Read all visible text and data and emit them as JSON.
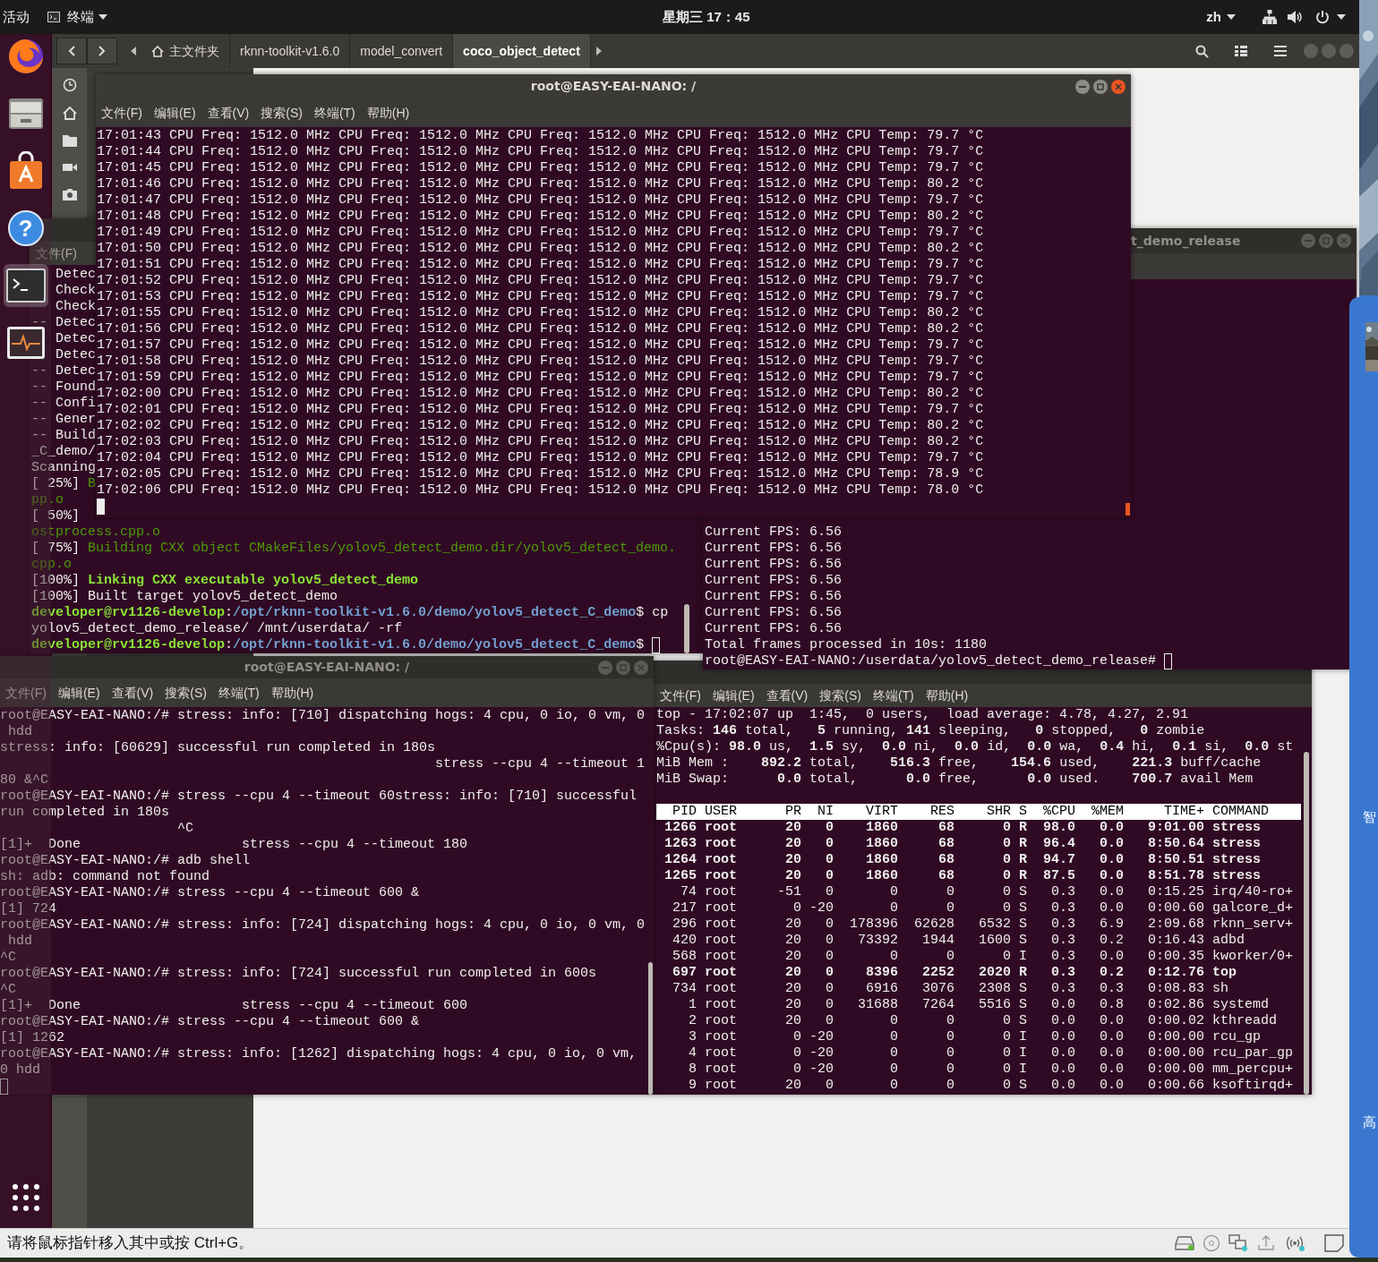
{
  "top_bar": {
    "activities": "活动",
    "app_menu": "终端",
    "clock": "星期三 17：45",
    "language": "zh"
  },
  "dock": {
    "items": [
      {
        "kind": "browser",
        "selected": false
      },
      {
        "kind": "files",
        "selected": false
      },
      {
        "kind": "store",
        "selected": false
      },
      {
        "kind": "help",
        "glyph": "?",
        "selected": false
      },
      {
        "kind": "terminal",
        "selected": true
      },
      {
        "kind": "monitor",
        "selected": false
      },
      {
        "kind": "apps",
        "selected": false
      }
    ]
  },
  "files_window": {
    "path": [
      {
        "kind": "home",
        "label": "主文件夹",
        "selected": false
      },
      {
        "kind": "folder",
        "label": "rknn-toolkit-v1.6.0",
        "selected": false
      },
      {
        "kind": "folder",
        "label": "model_convert",
        "selected": false
      },
      {
        "kind": "folder",
        "label": "coco_object_detect",
        "selected": true
      }
    ]
  },
  "build_terminal": {
    "menu": [
      "文件(F)"
    ],
    "lines": [
      "   Detec",
      "   Check",
      "   Check",
      "-- Detec",
      "   Detec",
      "   Detec",
      "-- Detec",
      "-- Found",
      "-- Confi",
      "-- Gener",
      "-- Build",
      "_C_demo/",
      "Scanning",
      {
        "spans": [
          {
            "kind": "plain",
            "text": "[ 25%] "
          },
          {
            "kind": "green",
            "text": "B"
          }
        ]
      },
      {
        "spans": [
          {
            "kind": "green",
            "text": "pp.o"
          }
        ]
      },
      "[ 50%]",
      {
        "spans": [
          {
            "kind": "green",
            "text": "ostprocess.cpp.o"
          }
        ]
      },
      {
        "spans": [
          {
            "kind": "plain",
            "text": "[ 75%] "
          },
          {
            "kind": "green",
            "text": "Building CXX object CMakeFiles/yolov5_detect_demo.dir/yolov5_detect_demo."
          }
        ]
      },
      {
        "spans": [
          {
            "kind": "green",
            "text": "cpp.o"
          }
        ]
      },
      {
        "spans": [
          {
            "kind": "plain",
            "text": "[100%] "
          },
          {
            "kind": "green-bold",
            "text": "Linking CXX executable yolov5_detect_demo"
          }
        ]
      },
      "[100%] Built target yolov5_detect_demo",
      {
        "spans": [
          {
            "kind": "user",
            "text": "developer@rv1126-develop"
          },
          {
            "kind": "plain",
            "text": ":"
          },
          {
            "kind": "path",
            "text": "/opt/rknn-toolkit-v1.6.0/demo/yolov5_detect_C_demo"
          },
          {
            "kind": "plain",
            "text": "$ cp"
          }
        ]
      },
      "yolov5_detect_demo_release/ /mnt/userdata/ -rf",
      {
        "spans": [
          {
            "kind": "user",
            "text": "developer@rv1126-develop"
          },
          {
            "kind": "plain",
            "text": ":"
          },
          {
            "kind": "path",
            "text": "/opt/rknn-toolkit-v1.6.0/demo/yolov5_detect_C_demo"
          },
          {
            "kind": "plain",
            "text": "$"
          }
        ],
        "cursor": true
      }
    ]
  },
  "fps_terminal": {
    "title": "t_demo_release",
    "focused": false,
    "lines": [
      "Current FPS: 6.56",
      "Current FPS: 6.56",
      "Current FPS: 6.56",
      "Current FPS: 6.56",
      "Current FPS: 6.56",
      "Current FPS: 6.56",
      "Current FPS: 6.56",
      "Total frames processed in 10s: 1180",
      {
        "text": "root@EASY-EAI-NANO:/userdata/yolov5_detect_demo_release#",
        "cursor": true
      }
    ]
  },
  "freq_terminal": {
    "title": "root@EASY-EAI-NANO: /",
    "focused": true,
    "menu": [
      "文件(F)",
      "编辑(E)",
      "查看(V)",
      "搜索(S)",
      "终端(T)",
      "帮助(H)"
    ],
    "lines": [
      "17:01:43 CPU Freq: 1512.0 MHz CPU Freq: 1512.0 MHz CPU Freq: 1512.0 MHz CPU Freq: 1512.0 MHz CPU Temp: 79.7 °C",
      "17:01:44 CPU Freq: 1512.0 MHz CPU Freq: 1512.0 MHz CPU Freq: 1512.0 MHz CPU Freq: 1512.0 MHz CPU Temp: 79.7 °C",
      "17:01:45 CPU Freq: 1512.0 MHz CPU Freq: 1512.0 MHz CPU Freq: 1512.0 MHz CPU Freq: 1512.0 MHz CPU Temp: 79.7 °C",
      "17:01:46 CPU Freq: 1512.0 MHz CPU Freq: 1512.0 MHz CPU Freq: 1512.0 MHz CPU Freq: 1512.0 MHz CPU Temp: 80.2 °C",
      "17:01:47 CPU Freq: 1512.0 MHz CPU Freq: 1512.0 MHz CPU Freq: 1512.0 MHz CPU Freq: 1512.0 MHz CPU Temp: 79.7 °C",
      "17:01:48 CPU Freq: 1512.0 MHz CPU Freq: 1512.0 MHz CPU Freq: 1512.0 MHz CPU Freq: 1512.0 MHz CPU Temp: 80.2 °C",
      "17:01:49 CPU Freq: 1512.0 MHz CPU Freq: 1512.0 MHz CPU Freq: 1512.0 MHz CPU Freq: 1512.0 MHz CPU Temp: 79.7 °C",
      "17:01:50 CPU Freq: 1512.0 MHz CPU Freq: 1512.0 MHz CPU Freq: 1512.0 MHz CPU Freq: 1512.0 MHz CPU Temp: 80.2 °C",
      "17:01:51 CPU Freq: 1512.0 MHz CPU Freq: 1512.0 MHz CPU Freq: 1512.0 MHz CPU Freq: 1512.0 MHz CPU Temp: 79.7 °C",
      "17:01:52 CPU Freq: 1512.0 MHz CPU Freq: 1512.0 MHz CPU Freq: 1512.0 MHz CPU Freq: 1512.0 MHz CPU Temp: 79.7 °C",
      "17:01:53 CPU Freq: 1512.0 MHz CPU Freq: 1512.0 MHz CPU Freq: 1512.0 MHz CPU Freq: 1512.0 MHz CPU Temp: 79.7 °C",
      "17:01:55 CPU Freq: 1512.0 MHz CPU Freq: 1512.0 MHz CPU Freq: 1512.0 MHz CPU Freq: 1512.0 MHz CPU Temp: 80.2 °C",
      "17:01:56 CPU Freq: 1512.0 MHz CPU Freq: 1512.0 MHz CPU Freq: 1512.0 MHz CPU Freq: 1512.0 MHz CPU Temp: 80.2 °C",
      "17:01:57 CPU Freq: 1512.0 MHz CPU Freq: 1512.0 MHz CPU Freq: 1512.0 MHz CPU Freq: 1512.0 MHz CPU Temp: 79.7 °C",
      "17:01:58 CPU Freq: 1512.0 MHz CPU Freq: 1512.0 MHz CPU Freq: 1512.0 MHz CPU Freq: 1512.0 MHz CPU Temp: 79.7 °C",
      "17:01:59 CPU Freq: 1512.0 MHz CPU Freq: 1512.0 MHz CPU Freq: 1512.0 MHz CPU Freq: 1512.0 MHz CPU Temp: 79.7 °C",
      "17:02:00 CPU Freq: 1512.0 MHz CPU Freq: 1512.0 MHz CPU Freq: 1512.0 MHz CPU Freq: 1512.0 MHz CPU Temp: 80.2 °C",
      "17:02:01 CPU Freq: 1512.0 MHz CPU Freq: 1512.0 MHz CPU Freq: 1512.0 MHz CPU Freq: 1512.0 MHz CPU Temp: 79.7 °C",
      "17:02:02 CPU Freq: 1512.0 MHz CPU Freq: 1512.0 MHz CPU Freq: 1512.0 MHz CPU Freq: 1512.0 MHz CPU Temp: 80.2 °C",
      "17:02:03 CPU Freq: 1512.0 MHz CPU Freq: 1512.0 MHz CPU Freq: 1512.0 MHz CPU Freq: 1512.0 MHz CPU Temp: 80.2 °C",
      "17:02:04 CPU Freq: 1512.0 MHz CPU Freq: 1512.0 MHz CPU Freq: 1512.0 MHz CPU Freq: 1512.0 MHz CPU Temp: 79.7 °C",
      "17:02:05 CPU Freq: 1512.0 MHz CPU Freq: 1512.0 MHz CPU Freq: 1512.0 MHz CPU Freq: 1512.0 MHz CPU Temp: 78.9 °C",
      "17:02:06 CPU Freq: 1512.0 MHz CPU Freq: 1512.0 MHz CPU Freq: 1512.0 MHz CPU Freq: 1512.0 MHz CPU Temp: 78.0 °C",
      {
        "cursor": true
      }
    ]
  },
  "stress_terminal": {
    "title": "root@EASY-EAI-NANO: /",
    "focused": false,
    "menu": [
      "文件(F)",
      "编辑(E)",
      "查看(V)",
      "搜索(S)",
      "终端(T)",
      "帮助(H)"
    ],
    "lines": [
      "root@EASY-EAI-NANO:/# stress: info: [710] dispatching hogs: 4 cpu, 0 io, 0 vm, 0",
      " hdd",
      "stress: info: [60629] successful run completed in 180s",
      "                                                      stress --cpu 4 --timeout 1",
      "80 &^C",
      "root@EASY-EAI-NANO:/# stress --cpu 4 --timeout 60stress: info: [710] successful",
      "run completed in 180s",
      "                      ^C",
      "[1]+  Done                    stress --cpu 4 --timeout 180",
      "root@EASY-EAI-NANO:/# adb shell",
      "sh: adb: command not found",
      "root@EASY-EAI-NANO:/# stress --cpu 4 --timeout 600 &",
      "[1] 724",
      "root@EASY-EAI-NANO:/# stress: info: [724] dispatching hogs: 4 cpu, 0 io, 0 vm, 0",
      " hdd",
      "^C",
      "root@EASY-EAI-NANO:/# stress: info: [724] successful run completed in 600s",
      "^C",
      "[1]+  Done                    stress --cpu 4 --timeout 600",
      "root@EASY-EAI-NANO:/# stress --cpu 4 --timeout 600 &",
      "[1] 1262",
      "root@EASY-EAI-NANO:/# stress: info: [1262] dispatching hogs: 4 cpu, 0 io, 0 vm,",
      "0 hdd",
      {
        "cursor": true
      }
    ]
  },
  "top_terminal": {
    "menu": [
      "文件(F)",
      "编辑(E)",
      "查看(V)",
      "搜索(S)",
      "终端(T)",
      "帮助(H)"
    ],
    "lines": [
      "top - 17:02:07 up  1:45,  0 users,  load average: 4.78, 4.27, 2.91",
      "Tasks: **146** total,   **5** running, **141** sleeping,   **0** stopped,   **0** zombie",
      "%Cpu(s): **98.0** us,  **1.5** sy,  **0.0** ni,  **0.0** id,  **0.0** wa,  **0.4** hi,  **0.1** si,  **0.0** st",
      "MiB Mem :    **892.2** total,    **516.3** free,    **154.6** used,    **221.3** buff/cache",
      "MiB Swap:      **0.0** total,      **0.0** free,      **0.0** used.    **700.7** avail Mem"
    ],
    "process_table": {
      "columns": [
        "PID",
        "USER",
        "PR",
        "NI",
        "VIRT",
        "RES",
        "SHR",
        "S",
        "%CPU",
        "%MEM",
        "TIME+",
        "COMMAND"
      ],
      "rows": [
        {
          "bold": true,
          "cells": [
            "1266",
            "root",
            "20",
            "0",
            "1860",
            "68",
            "0",
            "R",
            "98.0",
            "0.0",
            "9:01.00",
            "stress"
          ]
        },
        {
          "bold": true,
          "cells": [
            "1263",
            "root",
            "20",
            "0",
            "1860",
            "68",
            "0",
            "R",
            "96.4",
            "0.0",
            "8:50.64",
            "stress"
          ]
        },
        {
          "bold": true,
          "cells": [
            "1264",
            "root",
            "20",
            "0",
            "1860",
            "68",
            "0",
            "R",
            "94.7",
            "0.0",
            "8:50.51",
            "stress"
          ]
        },
        {
          "bold": true,
          "cells": [
            "1265",
            "root",
            "20",
            "0",
            "1860",
            "68",
            "0",
            "R",
            "87.5",
            "0.0",
            "8:51.78",
            "stress"
          ]
        },
        {
          "bold": false,
          "cells": [
            "74",
            "root",
            "-51",
            "0",
            "0",
            "0",
            "0",
            "S",
            "0.3",
            "0.0",
            "0:15.25",
            "irq/40-ro+"
          ]
        },
        {
          "bold": false,
          "cells": [
            "217",
            "root",
            "0",
            "-20",
            "0",
            "0",
            "0",
            "S",
            "0.3",
            "0.0",
            "0:00.60",
            "galcore_d+"
          ]
        },
        {
          "bold": false,
          "cells": [
            "296",
            "root",
            "20",
            "0",
            "178396",
            "62628",
            "6532",
            "S",
            "0.3",
            "6.9",
            "2:09.68",
            "rknn_serv+"
          ]
        },
        {
          "bold": false,
          "cells": [
            "420",
            "root",
            "20",
            "0",
            "73392",
            "1944",
            "1600",
            "S",
            "0.3",
            "0.2",
            "0:16.43",
            "adbd"
          ]
        },
        {
          "bold": false,
          "cells": [
            "568",
            "root",
            "20",
            "0",
            "0",
            "0",
            "0",
            "I",
            "0.3",
            "0.0",
            "0:00.35",
            "kworker/0+"
          ]
        },
        {
          "bold": true,
          "cells": [
            "697",
            "root",
            "20",
            "0",
            "8396",
            "2252",
            "2020",
            "R",
            "0.3",
            "0.2",
            "0:12.76",
            "top"
          ]
        },
        {
          "bold": false,
          "cells": [
            "734",
            "root",
            "20",
            "0",
            "6916",
            "3076",
            "2308",
            "S",
            "0.3",
            "0.3",
            "0:08.83",
            "sh"
          ]
        },
        {
          "bold": false,
          "cells": [
            "1",
            "root",
            "20",
            "0",
            "31688",
            "7264",
            "5516",
            "S",
            "0.0",
            "0.8",
            "0:02.86",
            "systemd"
          ]
        },
        {
          "bold": false,
          "cells": [
            "2",
            "root",
            "20",
            "0",
            "0",
            "0",
            "0",
            "S",
            "0.0",
            "0.0",
            "0:00.02",
            "kthreadd"
          ]
        },
        {
          "bold": false,
          "cells": [
            "3",
            "root",
            "0",
            "-20",
            "0",
            "0",
            "0",
            "I",
            "0.0",
            "0.0",
            "0:00.00",
            "rcu_gp"
          ]
        },
        {
          "bold": false,
          "cells": [
            "4",
            "root",
            "0",
            "-20",
            "0",
            "0",
            "0",
            "I",
            "0.0",
            "0.0",
            "0:00.00",
            "rcu_par_gp"
          ]
        },
        {
          "bold": false,
          "cells": [
            "8",
            "root",
            "0",
            "-20",
            "0",
            "0",
            "0",
            "I",
            "0.0",
            "0.0",
            "0:00.00",
            "mm_percpu+"
          ]
        },
        {
          "bold": false,
          "cells": [
            "9",
            "root",
            "20",
            "0",
            "0",
            "0",
            "0",
            "S",
            "0.0",
            "0.0",
            "0:00.66",
            "ksoftirqd+"
          ]
        }
      ]
    }
  },
  "side_panel": {
    "labels": [
      "智",
      "高"
    ]
  },
  "status_bar": {
    "hint": "请将鼠标指针移入其中或按 Ctrl+G。"
  }
}
